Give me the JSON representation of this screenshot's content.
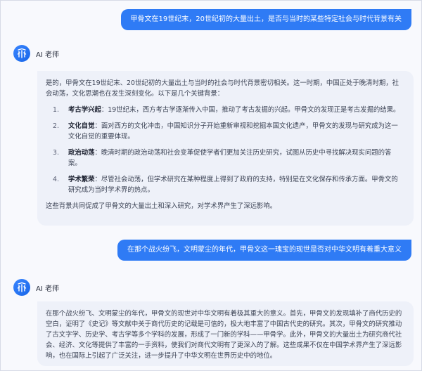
{
  "conversation": {
    "user_messages": [
      "甲骨文在19世纪末，20世纪初的大量出土，是否与当时的某些特定社会与时代背景有关",
      "在那个战火纷飞，文明蒙尘的年代，甲骨文这一瑰宝的现世是否对中华文明有着重大意义"
    ],
    "assistant": {
      "name": "AI 老师",
      "avatar_icon": "jia-gu-glyph-icon",
      "avatar_color": "#2f7bf5"
    },
    "reply1": {
      "intro": "是的，甲骨文在19世纪末、20世纪初的大量出土与当时的社会与时代背景密切相关。这一时期，中国正处于晚清时期，社会动荡，文化思潮也在发生深刻变化。以下是几个关键背景：",
      "items": [
        {
          "num": "1.",
          "title": "考古学兴起",
          "text": "：19世纪末，西方考古学逐渐传入中国，推动了考古发掘的兴起。甲骨文的发现正是考古发掘的结果。"
        },
        {
          "num": "2.",
          "title": "文化自觉",
          "text": "：面对西方的文化冲击，中国知识分子开始重新审视和挖掘本国文化遗产，甲骨文的发现与研究成为这一文化自觉的重要体现。"
        },
        {
          "num": "3.",
          "title": "政治动荡",
          "text": "：晚清时期的政治动荡和社会变革促使学者们更加关注历史研究，试图从历史中寻找解决现实问题的答案。"
        },
        {
          "num": "4.",
          "title": "学术繁荣",
          "text": "：尽管社会动荡，但学术研究在某种程度上得到了政府的支持，特别是在文化保存和传承方面。甲骨文的研究成为当时学术界的热点。"
        }
      ],
      "closing": "这些背景共同促成了甲骨文的大量出土和深入研究，对学术界产生了深远影响。"
    },
    "reply2": {
      "text": "在那个战火纷飞、文明蒙尘的年代，甲骨文的现世对中华文明有着极其重大的意义。首先，甲骨文的发现填补了商代历史的空白，证明了《史记》等文献中关于商代历史的记载是可信的，极大地丰富了中国古代史的研究。其次，甲骨文的研究推动了古文字学、历史学、考古学等多个学科的发展，形成了一门新的学科——甲骨学。此外，甲骨文的大量出土为研究商代社会、经济、文化等提供了丰富的一手资料，使我们对商代文明有了更深入的了解。这些成果不仅在中国学术界产生了深远影响，也在国际上引起了广泛关注，进一步提升了中华文明在世界历史中的地位。"
    }
  }
}
